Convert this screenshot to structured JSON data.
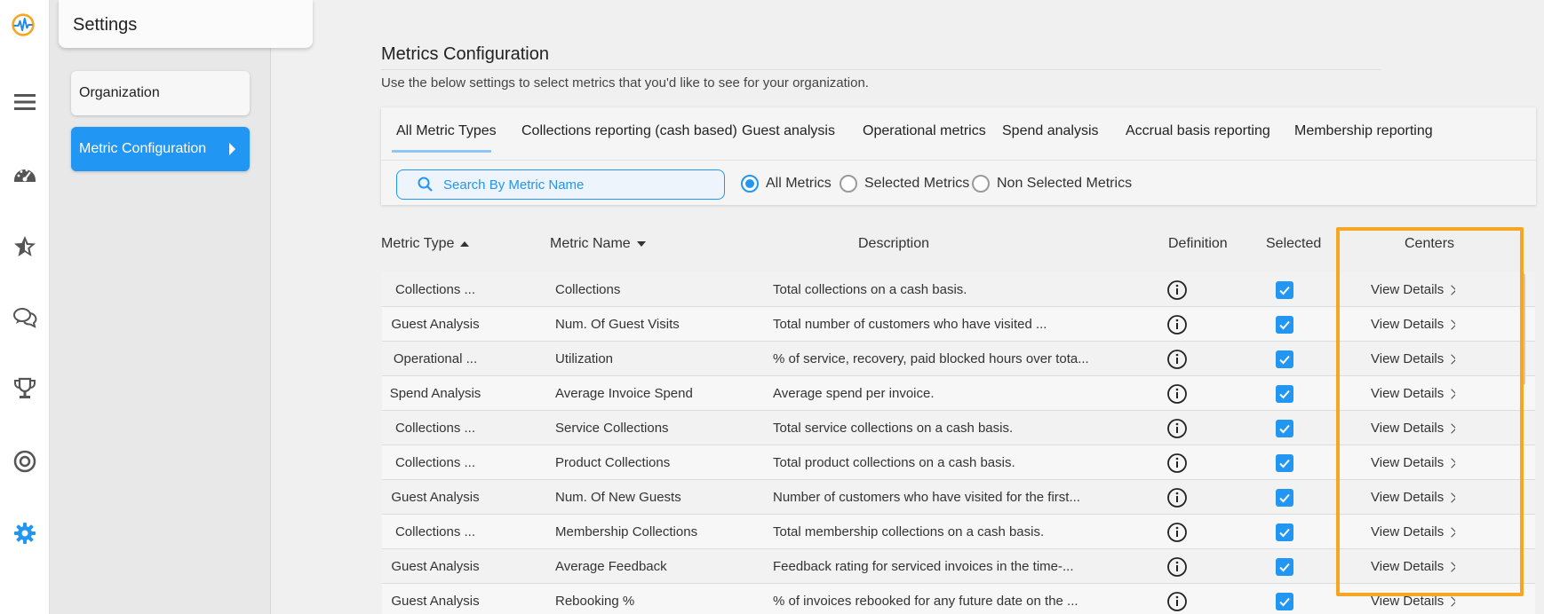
{
  "rail": {
    "icons": [
      "app-logo-icon",
      "menu-icon",
      "dashboard-icon",
      "star-icon",
      "chat-icon",
      "trophy-icon",
      "target-icon",
      "settings-gear-icon"
    ]
  },
  "panel": {
    "title": "Settings",
    "items": [
      {
        "label": "Organization"
      },
      {
        "label": "Metric Configuration"
      }
    ]
  },
  "main": {
    "title": "Metrics Configuration",
    "subtitle": "Use the below settings to select metrics that you'd like to see for your organization.",
    "tabs": [
      {
        "label": "All Metric Types"
      },
      {
        "label": "Collections reporting (cash based)"
      },
      {
        "label": "Guest analysis"
      },
      {
        "label": "Operational metrics"
      },
      {
        "label": "Spend analysis"
      },
      {
        "label": "Accrual basis reporting"
      },
      {
        "label": "Membership reporting"
      }
    ],
    "search": {
      "placeholder": "Search By Metric Name"
    },
    "filters": [
      {
        "label": "All Metrics",
        "selected": true
      },
      {
        "label": "Selected Metrics",
        "selected": false
      },
      {
        "label": "Non Selected Metrics",
        "selected": false
      }
    ]
  },
  "table": {
    "headers": {
      "type": "Metric Type",
      "name": "Metric Name",
      "description": "Description",
      "definition": "Definition",
      "selected": "Selected",
      "centers": "Centers"
    },
    "view_label": "View Details",
    "rows": [
      {
        "type": "Collections ...",
        "name": "Collections",
        "description": "Total collections on a cash basis."
      },
      {
        "type": "Guest Analysis",
        "name": "Num. Of Guest Visits",
        "description": "Total number of customers who have visited ..."
      },
      {
        "type": "Operational ...",
        "name": "Utilization",
        "description": "% of service, recovery, paid blocked hours over tota..."
      },
      {
        "type": "Spend Analysis",
        "name": "Average Invoice Spend",
        "description": "Average spend per invoice."
      },
      {
        "type": "Collections ...",
        "name": "Service Collections",
        "description": "Total service collections on a cash basis."
      },
      {
        "type": "Collections ...",
        "name": "Product Collections",
        "description": "Total product collections on a cash basis."
      },
      {
        "type": "Guest Analysis",
        "name": "Num. Of New Guests",
        "description": "Number of customers who have visited for the first..."
      },
      {
        "type": "Collections ...",
        "name": "Membership Collections",
        "description": "Total membership collections on a cash basis."
      },
      {
        "type": "Guest Analysis",
        "name": "Average Feedback",
        "description": "Feedback rating for serviced invoices in the time-..."
      },
      {
        "type": "Guest Analysis",
        "name": "Rebooking %",
        "description": "% of invoices rebooked for any future date on the ..."
      }
    ]
  },
  "colors": {
    "accent": "#2196f3",
    "highlight": "#f5a623"
  }
}
